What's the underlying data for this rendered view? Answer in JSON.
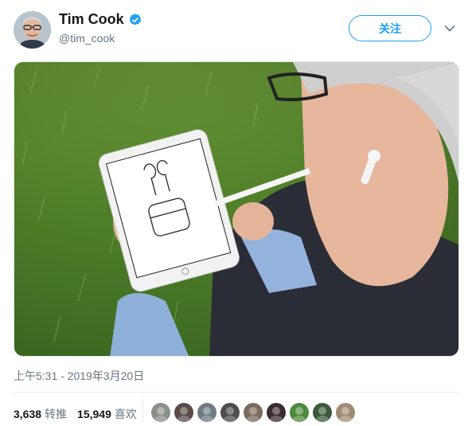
{
  "header": {
    "display_name": "Tim Cook",
    "handle": "@tim_cook",
    "follow_label": "关注",
    "verified": true
  },
  "media": {
    "description_icon": "photo-image"
  },
  "tweet": {
    "timestamp": "上午5:31 - 2019年3月20日"
  },
  "stats": {
    "retweets_count": "3,638",
    "retweets_label": "转推",
    "likes_count": "15,949",
    "likes_label": "喜欢"
  },
  "likers": [
    {
      "color": "#8a8f88"
    },
    {
      "color": "#5a4a4a"
    },
    {
      "color": "#6f7a82"
    },
    {
      "color": "#4d4d4d"
    },
    {
      "color": "#7b6a5e"
    },
    {
      "color": "#3b2c30"
    },
    {
      "color": "#4d8a3c"
    },
    {
      "color": "#3a5a3a"
    },
    {
      "color": "#a08c73"
    }
  ],
  "colors": {
    "accent": "#1da1f2",
    "secondary_text": "#657786"
  }
}
